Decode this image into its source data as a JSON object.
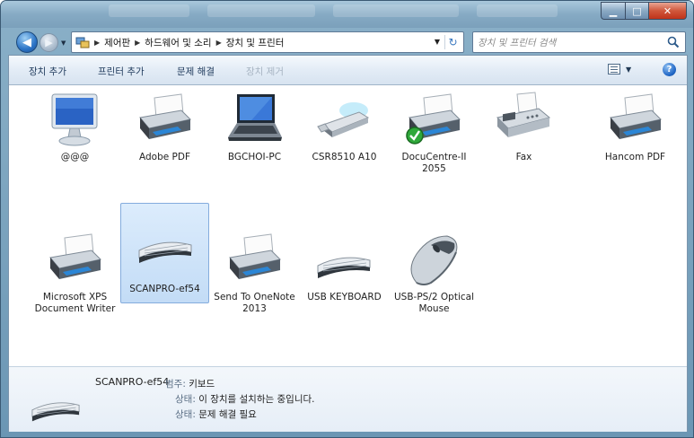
{
  "navigation": {
    "breadcrumb": [
      "제어판",
      "하드웨어 및 소리",
      "장치 및 프린터"
    ],
    "search_placeholder": "장치 및 프린터 검색"
  },
  "toolbar": {
    "add_device": "장치 추가",
    "add_printer": "프린터 추가",
    "troubleshoot": "문제 해결",
    "remove_device": "장치 제거"
  },
  "devices": [
    {
      "label": "@@@",
      "icon": "monitor-icon"
    },
    {
      "label": "Adobe PDF",
      "icon": "printer-icon"
    },
    {
      "label": "BGCHOI-PC",
      "icon": "laptop-icon"
    },
    {
      "label": "CSR8510 A10",
      "icon": "usb-dongle-icon"
    },
    {
      "label": "DocuCentre-II 2055",
      "icon": "printer-icon",
      "status": "default"
    },
    {
      "label": "Fax",
      "icon": "fax-icon"
    },
    {
      "label": "Hancom PDF",
      "icon": "printer-icon"
    },
    {
      "label": "Microsoft XPS Document Writer",
      "icon": "printer-icon"
    },
    {
      "label": "SCANPRO-ef54",
      "icon": "keyboard-icon",
      "selected": true
    },
    {
      "label": "Send To OneNote 2013",
      "icon": "printer-icon"
    },
    {
      "label": "USB KEYBOARD",
      "icon": "keyboard-icon"
    },
    {
      "label": "USB-PS/2 Optical Mouse",
      "icon": "mouse-icon"
    }
  ],
  "details": {
    "name": "SCANPRO-ef54",
    "category_label": "범주:",
    "category_value": "키보드",
    "status_label": "상태:",
    "status_value": "이 장치를 설치하는 중입니다.",
    "status2_label": "상태:",
    "status2_value": "문제 해결 필요"
  },
  "colors": {
    "selected_bg": "#c3dcf6",
    "toolbar_text": "#1e395b",
    "close_button": "#c0331a"
  }
}
